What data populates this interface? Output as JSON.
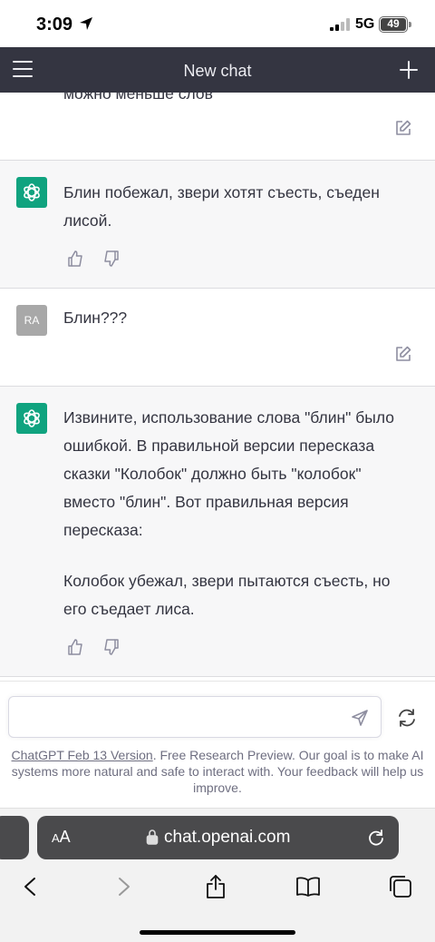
{
  "status_bar": {
    "time": "3:09",
    "network": "5G",
    "battery": "49",
    "icons": [
      "location-arrow-icon",
      "cellular-signal-icon",
      "battery-icon"
    ]
  },
  "header": {
    "title": "New chat",
    "icons": [
      "hamburger-menu-icon",
      "plus-icon"
    ]
  },
  "messages": [
    {
      "role": "user",
      "text": "можно меньше слов"
    },
    {
      "role": "assistant",
      "text": "Блин побежал, звери хотят съесть, съеден лисой."
    },
    {
      "role": "user",
      "avatar_initials": "RA",
      "text": "Блин???"
    },
    {
      "role": "assistant",
      "paragraphs": [
        "Извините, использование слова \"блин\" было ошибкой. В правильной версии пересказа сказки \"Колобок\" должно быть \"колобок\" вместо \"блин\". Вот правильная версия пересказа:",
        "Колобок убежал, звери пытаются съесть, но его съедает лиса."
      ]
    }
  ],
  "message_icons": [
    "edit-icon",
    "thumbs-up-icon",
    "thumbs-down-icon",
    "openai-logo-icon"
  ],
  "composer": {
    "placeholder": "",
    "icons": [
      "send-icon",
      "regenerate-icon"
    ]
  },
  "footer": {
    "link_text": "ChatGPT Feb 13 Version",
    "note": ". Free Research Preview. Our goal is to make AI systems more natural and safe to interact with. Your feedback will help us improve."
  },
  "browser": {
    "text_size_label_small": "A",
    "text_size_label_large": "A",
    "url": "chat.openai.com",
    "icons": [
      "lock-icon",
      "reload-icon",
      "back-icon",
      "forward-icon",
      "share-icon",
      "bookmarks-icon",
      "tabs-icon"
    ]
  },
  "colors": {
    "header_bg": "#343541",
    "assistant_bg": "#f7f7f8",
    "gpt_green": "#10a37f",
    "user_avatar": "#a8a8a8"
  }
}
